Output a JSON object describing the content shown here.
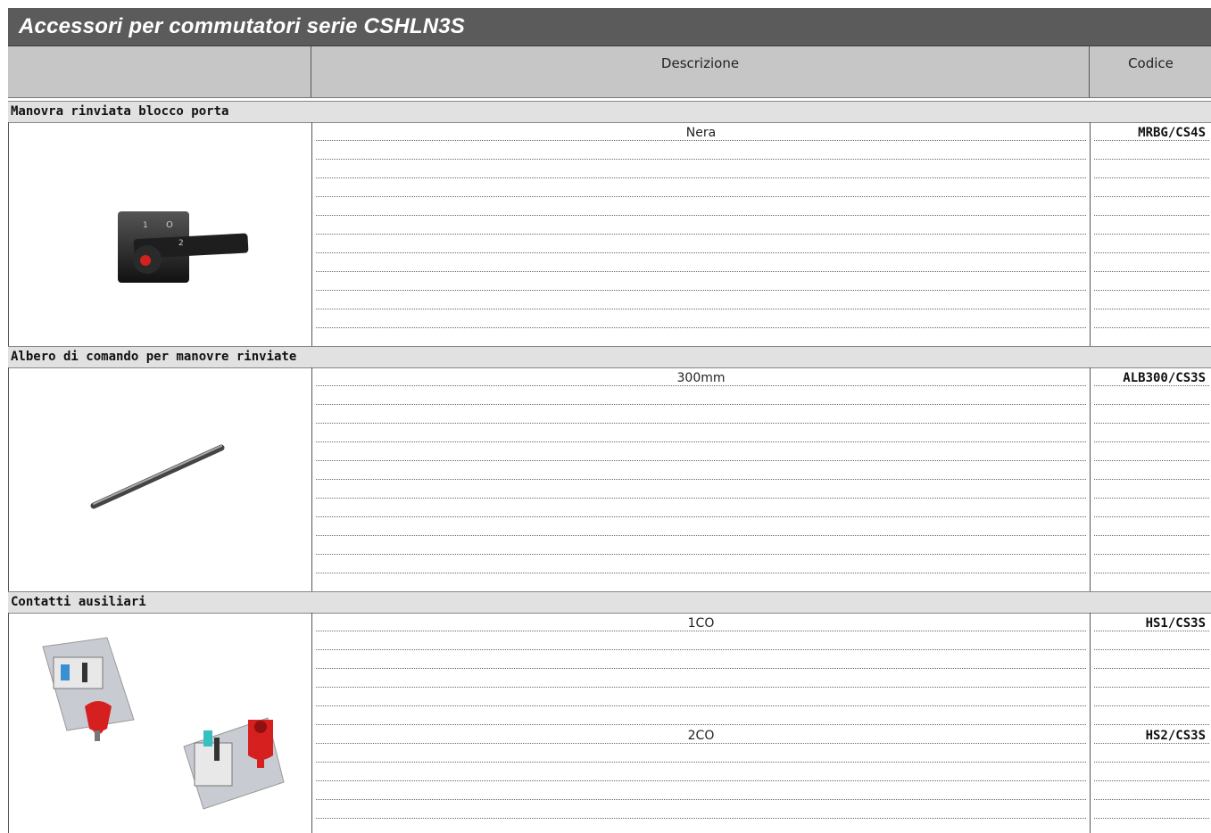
{
  "title": "Accessori per commutatori serie CSHLN3S",
  "columns": {
    "descrizione": "Descrizione",
    "codice": "Codice"
  },
  "sections": [
    {
      "title": "Manovra rinviata blocco porta",
      "rows": [
        {
          "desc": "Nera",
          "code": "MRBG/CS4S"
        }
      ],
      "image": "handle-switch-icon",
      "handle_marks": {
        "one": "1",
        "zero": "O",
        "two": "2"
      }
    },
    {
      "title": "Albero di comando per manovre rinviate",
      "rows": [
        {
          "desc": "300mm",
          "code": "ALB300/CS3S"
        }
      ],
      "image": "shaft-rod-icon"
    },
    {
      "title": "Contatti ausiliari",
      "rows": [
        {
          "desc": "1CO",
          "code": "HS1/CS3S"
        },
        {
          "desc": "2CO",
          "code": "HS2/CS3S"
        }
      ],
      "image": "auxiliary-contacts-icon"
    }
  ],
  "colors": {
    "title_bg": "#5b5b5b",
    "header_bg": "#c6c6c6",
    "section_bg": "#e1e1e1",
    "accent_red": "#d62020"
  }
}
